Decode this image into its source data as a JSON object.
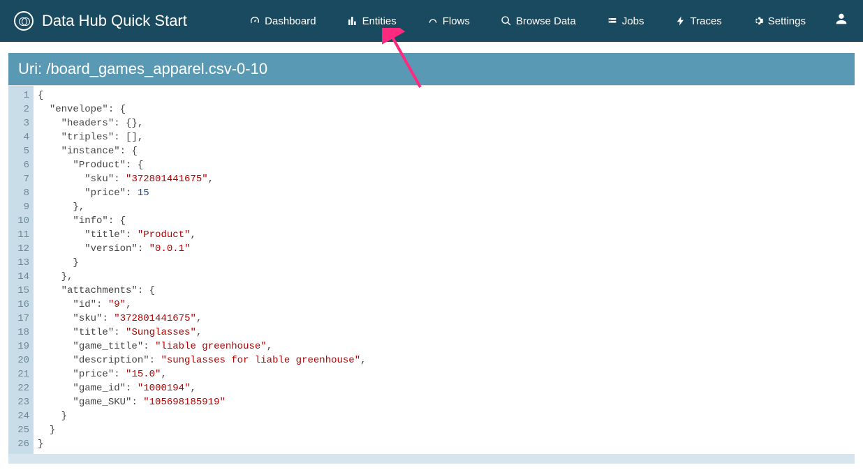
{
  "app_title": "Data Hub Quick Start",
  "nav": {
    "dashboard": "Dashboard",
    "entities": "Entities",
    "flows": "Flows",
    "browse": "Browse Data",
    "jobs": "Jobs",
    "traces": "Traces",
    "settings": "Settings"
  },
  "uri_label": "Uri: ",
  "uri_value": "/board_games_apparel.csv-0-10",
  "code_lines": [
    "{",
    "  \"envelope\": {",
    "    \"headers\": {},",
    "    \"triples\": [],",
    "    \"instance\": {",
    "      \"Product\": {",
    "        \"sku\": \"372801441675\",",
    "        \"price\": 15",
    "      },",
    "      \"info\": {",
    "        \"title\": \"Product\",",
    "        \"version\": \"0.0.1\"",
    "      }",
    "    },",
    "    \"attachments\": {",
    "      \"id\": \"9\",",
    "      \"sku\": \"372801441675\",",
    "      \"title\": \"Sunglasses\",",
    "      \"game_title\": \"liable greenhouse\",",
    "      \"description\": \"sunglasses for liable greenhouse\",",
    "      \"price\": \"15.0\",",
    "      \"game_id\": \"1000194\",",
    "      \"game_SKU\": \"105698185919\"",
    "    }",
    "  }",
    "}"
  ]
}
